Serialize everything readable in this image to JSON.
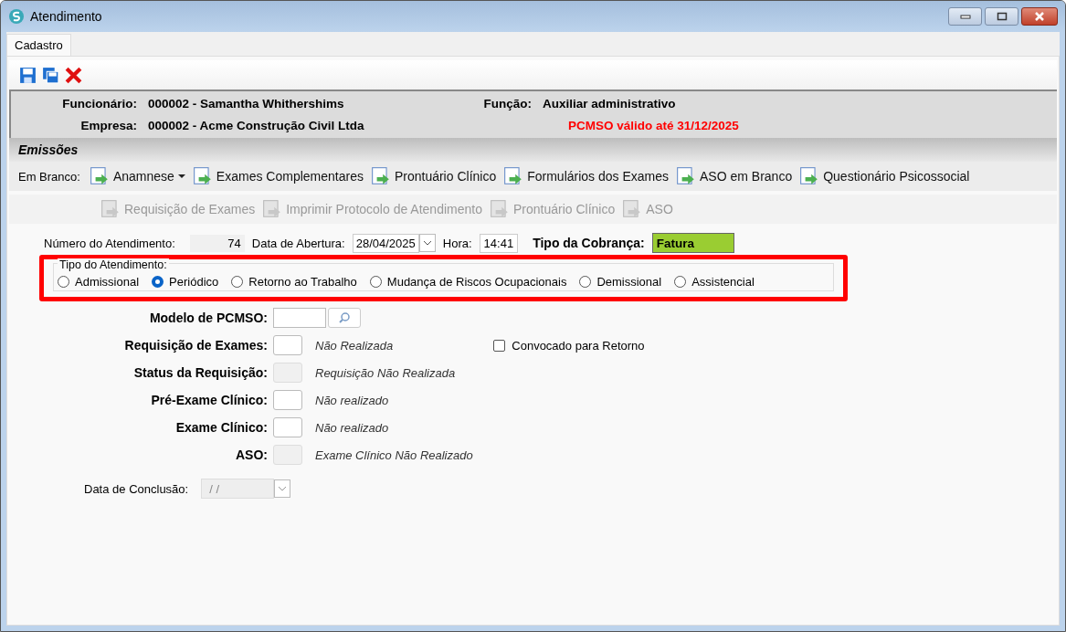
{
  "window": {
    "title": "Atendimento"
  },
  "tabs": [
    {
      "label": "Cadastro",
      "selected": true
    }
  ],
  "header": {
    "fields": [
      {
        "label": "Funcionário:",
        "value": "000002 - Samantha Whithershims"
      },
      {
        "label": "Função:",
        "value": "Auxiliar administrativo"
      },
      {
        "label": "Empresa:",
        "value": "000002 - Acme Construção Civil Ltda"
      }
    ],
    "warning": "PCMSO válido até 31/12/2025"
  },
  "emissoes": {
    "title": "Emissões",
    "blank_label": "Em Branco:",
    "blank_items": [
      {
        "label": "Anamnese",
        "disabled": false,
        "has_menu": true
      },
      {
        "label": "Exames Complementares",
        "disabled": false,
        "has_menu": false
      },
      {
        "label": "Prontuário Clínico",
        "disabled": false,
        "has_menu": false
      },
      {
        "label": "Formulários dos Exames",
        "disabled": false,
        "has_menu": false
      },
      {
        "label": "ASO em Branco",
        "disabled": false,
        "has_menu": false
      },
      {
        "label": "Questionário Psicossocial",
        "disabled": false,
        "has_menu": false
      }
    ],
    "items": [
      {
        "label": "Requisição de Exames",
        "disabled": true,
        "has_menu": false
      },
      {
        "label": "Imprimir Protocolo de Atendimento",
        "disabled": true,
        "has_menu": false
      },
      {
        "label": "Prontuário Clínico",
        "disabled": true,
        "has_menu": false
      },
      {
        "label": "ASO",
        "disabled": true,
        "has_menu": false
      }
    ]
  },
  "atendimento": {
    "number_label": "Número do Atendimento:",
    "number": "74",
    "date_label": "Data de Abertura:",
    "date": "28/04/2025",
    "time_label": "Hora:",
    "time": "14:41",
    "billing_label": "Tipo da Cobrança:",
    "billing": "Fatura",
    "color": "#9acd32"
  },
  "tipo": {
    "legend": "Tipo do Atendimento:",
    "options": [
      {
        "label": "Admissional",
        "selected": false
      },
      {
        "label": "Periódico",
        "selected": true
      },
      {
        "label": "Retorno ao Trabalho",
        "selected": false
      },
      {
        "label": "Mudança de Riscos Ocupacionais",
        "selected": false
      },
      {
        "label": "Demissional",
        "selected": false
      },
      {
        "label": "Assistencial",
        "selected": false
      }
    ]
  },
  "form": [
    {
      "kind": "search",
      "label": "Modelo de PCMSO:",
      "disabled": false
    },
    {
      "kind": "status",
      "label": "Requisição de Exames:",
      "disabled": false,
      "status": "Não Realizada"
    },
    {
      "kind": "status",
      "label": "Status da Requisição:",
      "disabled": true,
      "status": "Requisição Não Realizada"
    },
    {
      "kind": "status",
      "label": "Pré-Exame Clínico:",
      "disabled": false,
      "status": "Não realizado"
    },
    {
      "kind": "status",
      "label": "Exame Clínico:",
      "disabled": false,
      "status": "Não realizado"
    },
    {
      "kind": "status",
      "label": "ASO:",
      "disabled": true,
      "status": "Exame Clínico Não Realizado"
    }
  ],
  "convocado": {
    "label": "Convocado para Retorno",
    "checked": false
  },
  "conclusao": {
    "label": "Data de Conclusão:",
    "value": "/ /",
    "disabled": true
  }
}
